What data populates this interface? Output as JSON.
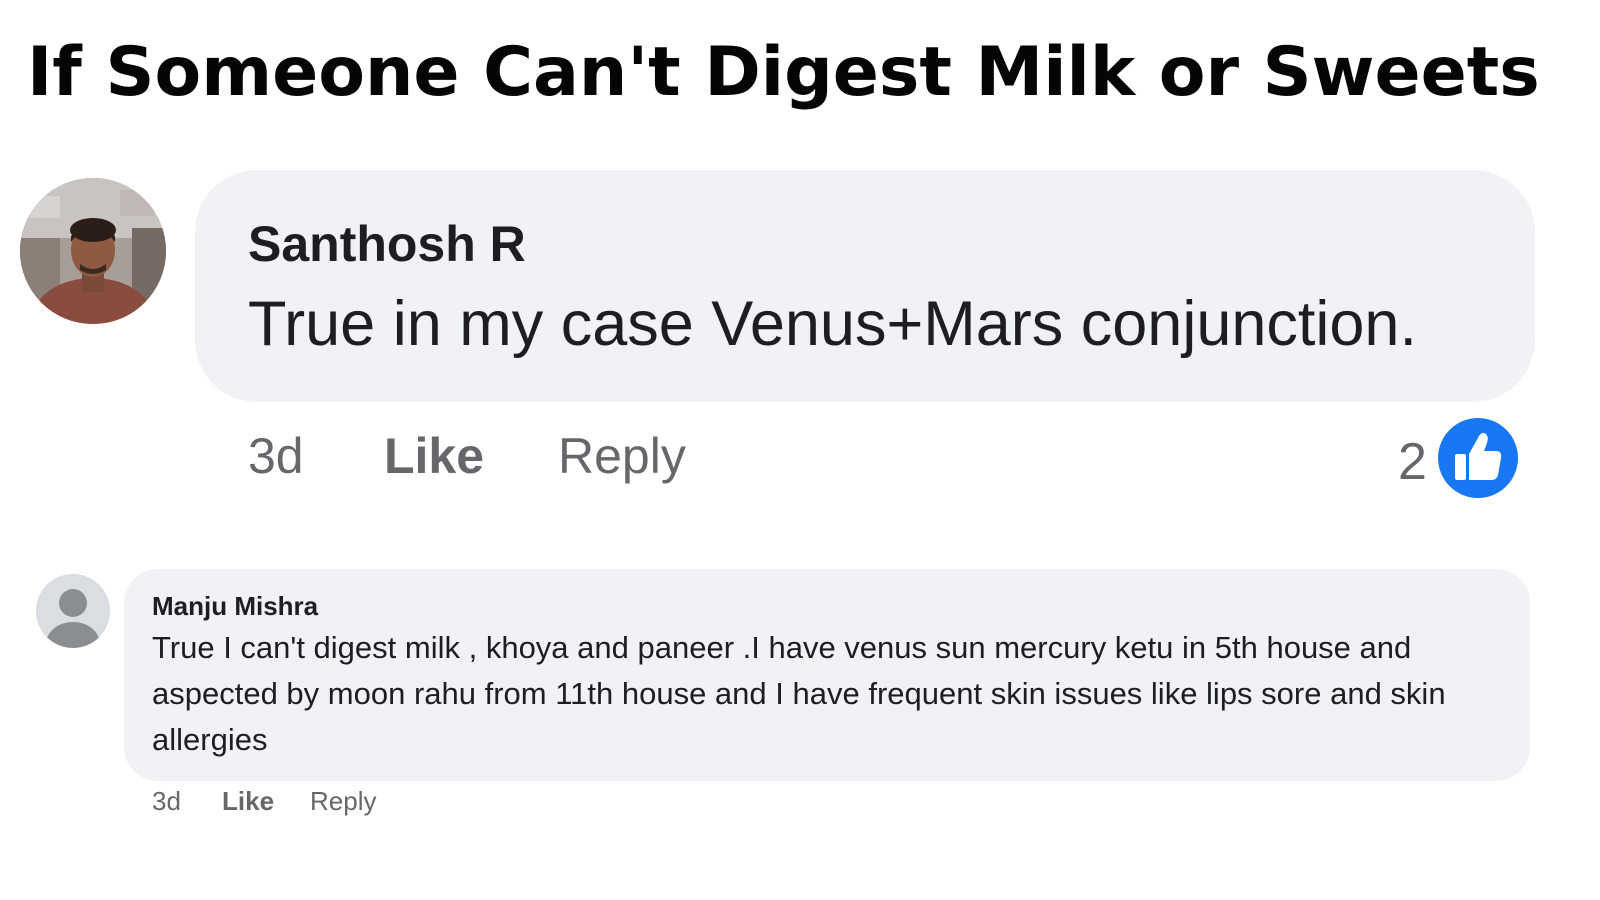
{
  "headline": "If Someone Can't Digest Milk or Sweets",
  "comments": [
    {
      "author": "Santhosh R",
      "text": "True in my case Venus+Mars conjunction.",
      "time": "3d",
      "like_label": "Like",
      "reply_label": "Reply",
      "reaction_count": "2",
      "reaction_icon": "thumbs-up-icon",
      "avatar": "profile-photo"
    },
    {
      "author": "Manju Mishra",
      "text": "True I can't digest milk , khoya and paneer .I have venus sun mercury ketu in 5th house and aspected by moon rahu from 11th house and I have frequent skin issues like lips sore and skin allergies",
      "time": "3d",
      "like_label": "Like",
      "reply_label": "Reply",
      "avatar": "default-avatar-icon"
    }
  ],
  "colors": {
    "bubble": "#f0f2f5",
    "text": "#1c1e21",
    "meta": "#65676b",
    "like_blue": "#1877f2"
  }
}
